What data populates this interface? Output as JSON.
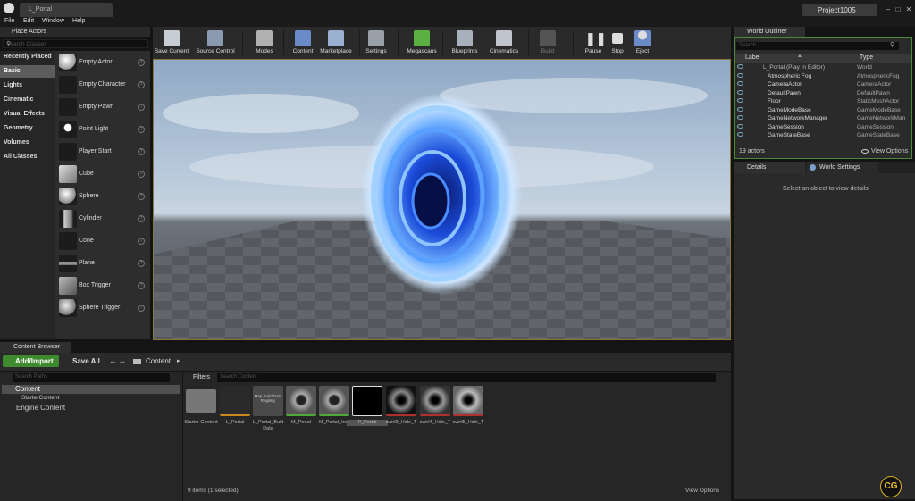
{
  "window": {
    "level_tab": "L_Portal",
    "project_name": "Project1005",
    "menu": [
      "File",
      "Edit",
      "Window",
      "Help"
    ]
  },
  "place_actors": {
    "title": "Place Actors",
    "search_placeholder": "Search Classes",
    "categories": [
      "Recently Placed",
      "Basic",
      "Lights",
      "Cinematic",
      "Visual Effects",
      "Geometry",
      "Volumes",
      "All Classes"
    ],
    "selected_category": "Basic",
    "items": [
      "Empty Actor",
      "Empty Character",
      "Empty Pawn",
      "Point Light",
      "Player Start",
      "Cube",
      "Sphere",
      "Cylinder",
      "Cone",
      "Plane",
      "Box Trigger",
      "Sphere Trigger"
    ]
  },
  "toolbar": {
    "buttons": [
      "Save Current",
      "Source Control",
      "Modes",
      "Content",
      "Marketplace",
      "Settings",
      "Megascans",
      "Blueprints",
      "Cinematics",
      "Build",
      "Pause",
      "Stop",
      "Eject"
    ]
  },
  "world_outliner": {
    "title": "World Outliner",
    "search_placeholder": "Search...",
    "col_label": "Label",
    "col_type": "Type",
    "rows": [
      {
        "name": "L_Portal (Play In Editor)",
        "type": "World"
      },
      {
        "name": "Atmospheric Fog",
        "type": "AtmosphericFog"
      },
      {
        "name": "CameraActor",
        "type": "CameraActor"
      },
      {
        "name": "DefaultPawn",
        "type": "DefaultPawn"
      },
      {
        "name": "Floor",
        "type": "StaticMeshActor"
      },
      {
        "name": "GameModeBase",
        "type": "GameModeBase"
      },
      {
        "name": "GameNetworkManager",
        "type": "GameNetworkMan"
      },
      {
        "name": "GameSession",
        "type": "GameSession"
      },
      {
        "name": "GameStateBase",
        "type": "GameStateBase"
      }
    ],
    "actor_count": "19 actors",
    "view_options": "View Options"
  },
  "details": {
    "tab_details": "Details",
    "tab_world_settings": "World Settings",
    "empty_message": "Select an object to view details."
  },
  "content_browser": {
    "title": "Content Browser",
    "add_import": "Add/Import",
    "save_all": "Save All",
    "path": "Content",
    "paths_placeholder": "Search Paths",
    "tree": [
      "Content",
      "StarterContent",
      "Engine Content"
    ],
    "filters": "Filters",
    "assets_placeholder": "Search Content",
    "assets": [
      {
        "label": "Starter Content",
        "kind": "folder",
        "color": "#8a8a8a"
      },
      {
        "label": "L_Portal",
        "kind": "level",
        "color": "#c98a1e"
      },
      {
        "label": "L_Portal_Built Data",
        "kind": "registry",
        "color": "#555555",
        "thumb_text": "Map Build Data Registry"
      },
      {
        "label": "M_Portal",
        "kind": "material",
        "color": "#4caa3c"
      },
      {
        "label": "M_Portal_Inst",
        "kind": "material-instance",
        "color": "#4caa3c"
      },
      {
        "label": "P_Portal",
        "kind": "particle",
        "color": "#ffffff",
        "selected": true
      },
      {
        "label": "swirl3_Hole_T",
        "kind": "texture",
        "color": "#b03030"
      },
      {
        "label": "swirl4_Hole_T",
        "kind": "texture",
        "color": "#b03030"
      },
      {
        "label": "swirl5_Hole_T",
        "kind": "texture",
        "color": "#b03030"
      }
    ],
    "status": "9 items (1 selected)",
    "view_options": "View Options"
  },
  "watermark": "CG"
}
